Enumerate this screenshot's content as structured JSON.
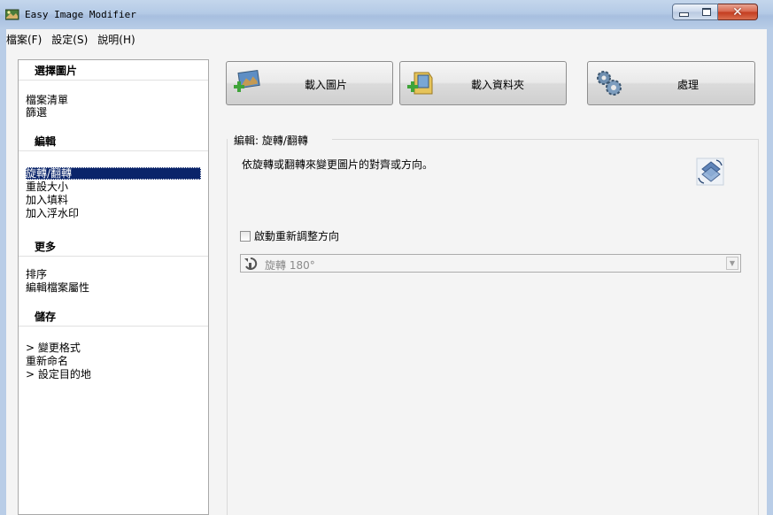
{
  "window": {
    "title": "Easy Image Modifier",
    "controls": {
      "minimize_icon": "minimize-icon",
      "maximize_icon": "maximize-icon",
      "close_label": "✕"
    }
  },
  "menu": [
    "檔案(F)",
    "設定(S)",
    "說明(H)"
  ],
  "sidebar": {
    "sections": [
      {
        "header": "選擇圖片",
        "items": [
          "檔案清單",
          "篩選"
        ]
      },
      {
        "header": "編輯",
        "items": [
          "旋轉/翻轉",
          "重設大小",
          "加入填料",
          "加入浮水印"
        ],
        "selected_index": 0
      },
      {
        "header": "更多",
        "items": [
          "排序",
          "編輯檔案屬性"
        ]
      },
      {
        "header": "儲存",
        "items": [
          "> 變更格式",
          "重新命名",
          "> 設定目的地"
        ]
      }
    ]
  },
  "toolbar": {
    "load_images": "載入圖片",
    "load_folder": "載入資料夾",
    "process": "處理"
  },
  "editor": {
    "group_title": "編輯: 旋轉/翻轉",
    "description": "依旋轉或翻轉來變更圖片的對齊或方向。",
    "checkbox_label": "啟動重新調整方向",
    "checkbox_checked": false,
    "rotation_select": "旋轉 180°"
  },
  "colors": {
    "selection_bg": "#0a246a",
    "titlebar": "#b4cae6",
    "close_button": "#c33b1e"
  }
}
